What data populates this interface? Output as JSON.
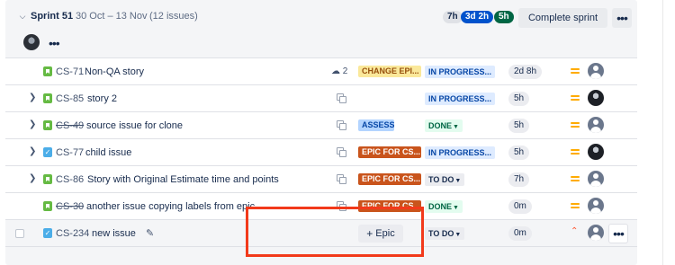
{
  "sprint": {
    "name": "Sprint 51",
    "dates": "30 Oct – 13 Nov",
    "issue_count": "(12 issues)",
    "estimates": {
      "todo": "7h",
      "in_progress": "3d 2h",
      "done": "5h"
    },
    "complete_label": "Complete sprint"
  },
  "colors": {
    "accent_blue": "#0052cc",
    "done_green": "#006644",
    "highlight": "#f23a1b"
  },
  "issues": [
    {
      "key": "CS-71",
      "summary": "Non-QA story",
      "type": "story-icon",
      "children": "2",
      "epic": "CHANGE EPI...",
      "status": "IN PROGRESS...",
      "estimate": "2d 8h",
      "priority": "medium-priority-icon",
      "assignee": "default-avatar"
    },
    {
      "key": "CS-85",
      "summary": "story 2",
      "type": "story-icon",
      "epic": "",
      "status": "IN PROGRESS...",
      "estimate": "5h",
      "priority": "medium-priority-icon",
      "assignee": "photo-avatar"
    },
    {
      "key": "CS-49",
      "summary": "source issue for clone",
      "type": "story-icon",
      "epic": "ASSESS",
      "status": "DONE",
      "estimate": "5h",
      "priority": "medium-priority-icon",
      "assignee": "default-avatar"
    },
    {
      "key": "CS-77",
      "summary": "child issue",
      "type": "task-icon",
      "epic": "EPIC FOR CS...",
      "status": "IN PROGRESS...",
      "estimate": "5h",
      "priority": "medium-priority-icon",
      "assignee": "photo-avatar"
    },
    {
      "key": "CS-86",
      "summary": "Story with Original Estimate time and points",
      "type": "story-icon",
      "epic": "EPIC FOR CS...",
      "status": "TO DO",
      "estimate": "7h",
      "priority": "medium-priority-icon",
      "assignee": "default-avatar"
    },
    {
      "key": "CS-30",
      "summary": "another issue copying labels from epic",
      "type": "story-icon",
      "epic": "EPIC FOR CS...",
      "status": "DONE",
      "estimate": "0m",
      "priority": "medium-priority-icon",
      "assignee": "default-avatar"
    },
    {
      "key": "CS-234",
      "summary": "new issue",
      "type": "task-icon",
      "epic_button": "Epic",
      "status": "TO DO",
      "estimate": "0m",
      "priority": "highest-priority-icon",
      "assignee": "default-avatar"
    }
  ]
}
